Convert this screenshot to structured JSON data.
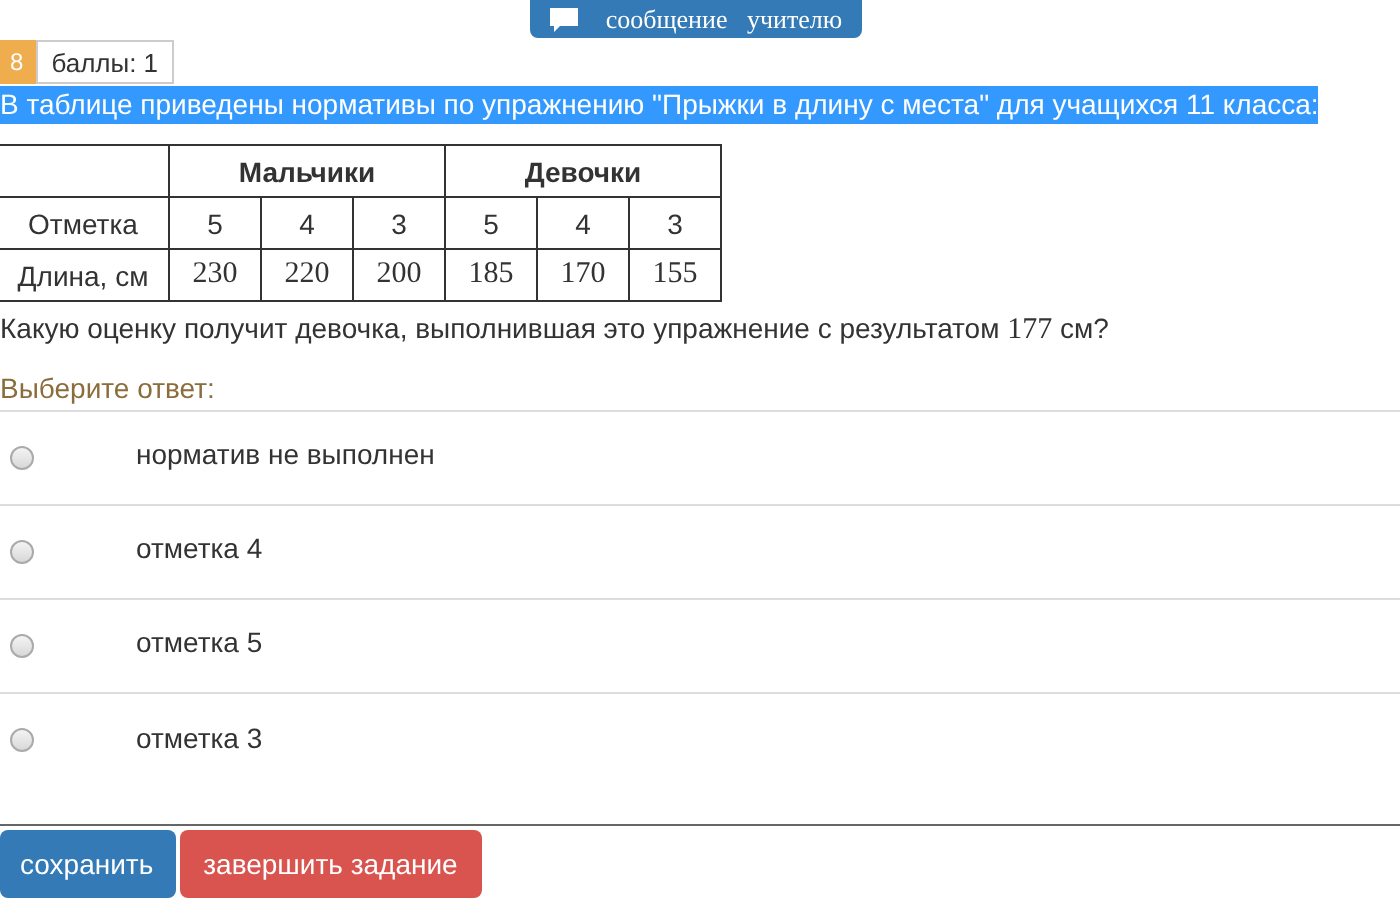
{
  "message_button": "сообщение   учителю",
  "task": {
    "number": "8",
    "score": "баллы: 1"
  },
  "intro": "В таблице приведены нормативы по упражнению \"Прыжки в длину с места\" для учащихся 11 класса:",
  "table": {
    "groups": [
      "Мальчики",
      "Девочки"
    ],
    "rows": [
      {
        "label": "Отметка",
        "kind": "text",
        "cells": [
          "5",
          "4",
          "3",
          "5",
          "4",
          "3"
        ]
      },
      {
        "label": "Длина, см",
        "kind": "number",
        "cells": [
          "230",
          "220",
          "200",
          "185",
          "170",
          "155"
        ]
      }
    ]
  },
  "question": [
    {
      "kind": "text",
      "text": "Какую оценку получит девочка, выполнившая это упражнение с результатом "
    },
    {
      "kind": "number",
      "text": "177"
    },
    {
      "kind": "text",
      "text": " см?"
    }
  ],
  "prompt": "Выберите ответ:",
  "options": [
    {
      "label": "норматив не выполнен",
      "selected": false
    },
    {
      "label": "отметка 4",
      "selected": false
    },
    {
      "label": "отметка 5",
      "selected": false
    },
    {
      "label": "отметка 3",
      "selected": false
    }
  ],
  "buttons": [
    {
      "label": "сохранить",
      "kind": "primary"
    },
    {
      "label": "завершить задание",
      "kind": "danger"
    }
  ]
}
